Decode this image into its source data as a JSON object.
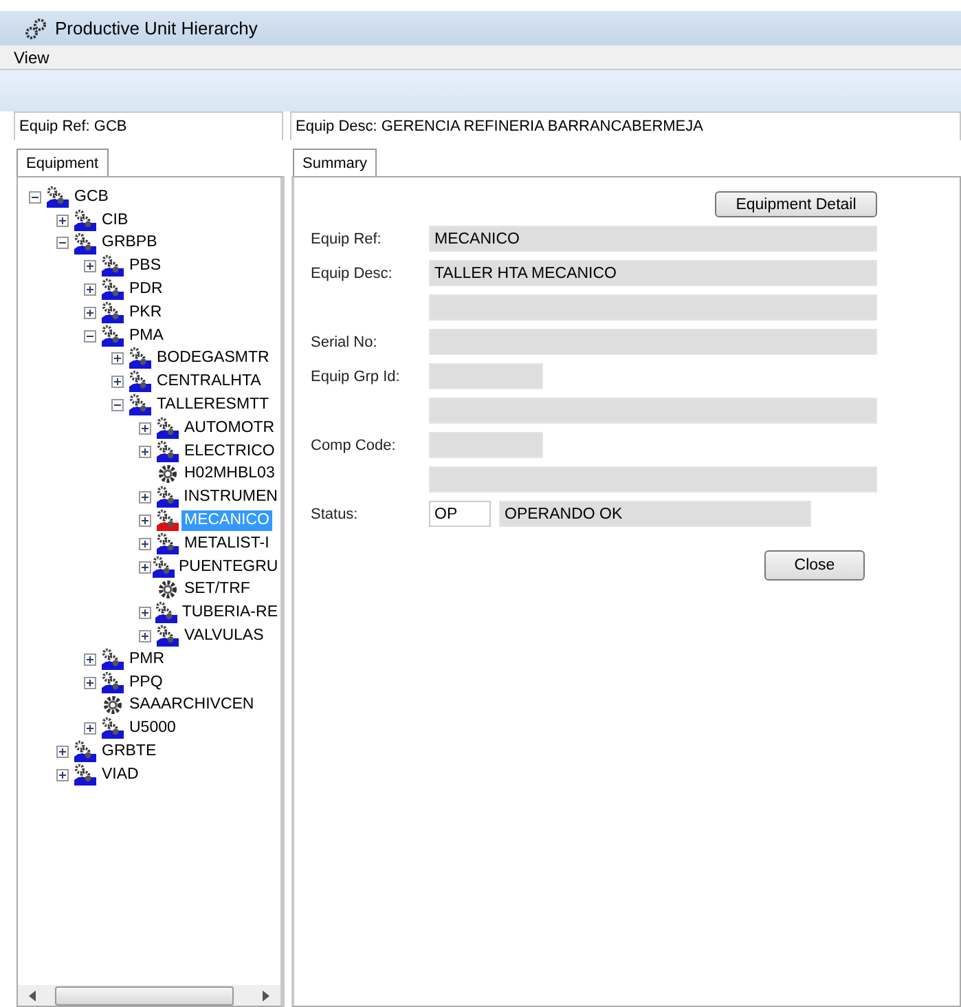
{
  "window": {
    "title": "Productive Unit Hierarchy"
  },
  "menu": [
    "View"
  ],
  "header": {
    "equip_ref": "Equip Ref: GCB",
    "equip_desc": "Equip Desc: GERENCIA REFINERIA BARRANCABERMEJA"
  },
  "left_tabs": [
    {
      "label": "Equipment",
      "selected": true
    }
  ],
  "right_tabs": [
    {
      "label": "Summary",
      "selected": true
    }
  ],
  "tree": [
    {
      "label": "GCB",
      "kind": "unit",
      "color": "#1414d8",
      "expanded": true,
      "selected": false,
      "children": [
        {
          "label": "CIB",
          "kind": "unit",
          "color": "#1414d8",
          "expanded": false,
          "selected": false
        },
        {
          "label": "GRBPB",
          "kind": "unit",
          "color": "#1414d8",
          "expanded": true,
          "selected": false,
          "children": [
            {
              "label": "PBS",
              "kind": "unit",
              "color": "#1414d8",
              "expanded": false,
              "selected": false
            },
            {
              "label": "PDR",
              "kind": "unit",
              "color": "#1414d8",
              "expanded": false,
              "selected": false
            },
            {
              "label": "PKR",
              "kind": "unit",
              "color": "#1414d8",
              "expanded": false,
              "selected": false
            },
            {
              "label": "PMA",
              "kind": "unit",
              "color": "#1414d8",
              "expanded": true,
              "selected": false,
              "children": [
                {
                  "label": "BODEGASMTR",
                  "kind": "unit",
                  "color": "#1414d8",
                  "expanded": false,
                  "selected": false
                },
                {
                  "label": "CENTRALHTA",
                  "kind": "unit",
                  "color": "#1414d8",
                  "expanded": false,
                  "selected": false
                },
                {
                  "label": "TALLERESMTT",
                  "kind": "unit",
                  "color": "#1414d8",
                  "expanded": true,
                  "selected": false,
                  "children": [
                    {
                      "label": "AUTOMOTR",
                      "kind": "unit",
                      "color": "#1414d8",
                      "expanded": false,
                      "selected": false
                    },
                    {
                      "label": "ELECTRICO",
                      "kind": "unit",
                      "color": "#1414d8",
                      "expanded": false,
                      "selected": false
                    },
                    {
                      "label": "H02MHBL03",
                      "kind": "item",
                      "selected": false
                    },
                    {
                      "label": "INSTRUMEN",
                      "kind": "unit",
                      "color": "#1414d8",
                      "expanded": false,
                      "selected": false
                    },
                    {
                      "label": "MECANICO",
                      "kind": "unit",
                      "color": "#e01010",
                      "expanded": false,
                      "selected": true
                    },
                    {
                      "label": "METALIST-I",
                      "kind": "unit",
                      "color": "#1414d8",
                      "expanded": false,
                      "selected": false
                    },
                    {
                      "label": "PUENTEGRU",
                      "kind": "unit",
                      "color": "#1414d8",
                      "expanded": false,
                      "selected": false
                    },
                    {
                      "label": "SET/TRF",
                      "kind": "item",
                      "selected": false
                    },
                    {
                      "label": "TUBERIA-RE",
                      "kind": "unit",
                      "color": "#1414d8",
                      "expanded": false,
                      "selected": false
                    },
                    {
                      "label": "VALVULAS",
                      "kind": "unit",
                      "color": "#1414d8",
                      "expanded": false,
                      "selected": false
                    }
                  ]
                }
              ]
            },
            {
              "label": "PMR",
              "kind": "unit",
              "color": "#1414d8",
              "expanded": false,
              "selected": false
            },
            {
              "label": "PPQ",
              "kind": "unit",
              "color": "#1414d8",
              "expanded": false,
              "selected": false
            },
            {
              "label": "SAAARCHIVCEN",
              "kind": "item",
              "selected": false
            },
            {
              "label": "U5000",
              "kind": "unit",
              "color": "#1414d8",
              "expanded": false,
              "selected": false
            }
          ]
        },
        {
          "label": "GRBTE",
          "kind": "unit",
          "color": "#1414d8",
          "expanded": false,
          "selected": false
        },
        {
          "label": "VIAD",
          "kind": "unit",
          "color": "#1414d8",
          "expanded": false,
          "selected": false
        }
      ]
    }
  ],
  "summary": {
    "detail_button": "Equipment Detail",
    "fields": [
      {
        "label": "Equip Ref:",
        "kind": "wide",
        "value": "MECANICO"
      },
      {
        "label": "Equip Desc:",
        "kind": "wide",
        "value": "TALLER HTA MECANICO"
      },
      {
        "kind": "wide"
      },
      {
        "label": "Serial No:",
        "kind": "wide"
      },
      {
        "label": "Equip Grp Id:",
        "kind": "narrow"
      },
      {
        "kind": "wide"
      },
      {
        "label": "Comp Code:",
        "kind": "narrow"
      },
      {
        "kind": "wide"
      },
      {
        "label": "Status:",
        "kind": "status",
        "code": "OP",
        "value": "OPERANDO OK"
      }
    ],
    "close_button": "Close"
  }
}
